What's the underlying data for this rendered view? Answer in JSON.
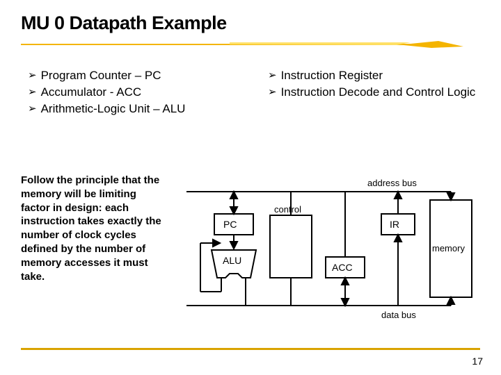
{
  "title": "MU 0 Datapath Example",
  "left_bullets": [
    "Program Counter – PC",
    "Accumulator - ACC",
    "Arithmetic-Logic Unit – ALU"
  ],
  "right_bullets": [
    "Instruction Register",
    "Instruction Decode and Control Logic"
  ],
  "principle": "Follow the principle that the memory will be limiting factor in design: each instruction takes exactly the number of clock cycles defined by the number of memory accesses it must take.",
  "diagram": {
    "address_bus_label": "address bus",
    "data_bus_label": "data bus",
    "pc": "PC",
    "ir": "IR",
    "alu": "ALU",
    "acc": "ACC",
    "memory": "memory",
    "control": "control"
  },
  "page_number": "17"
}
